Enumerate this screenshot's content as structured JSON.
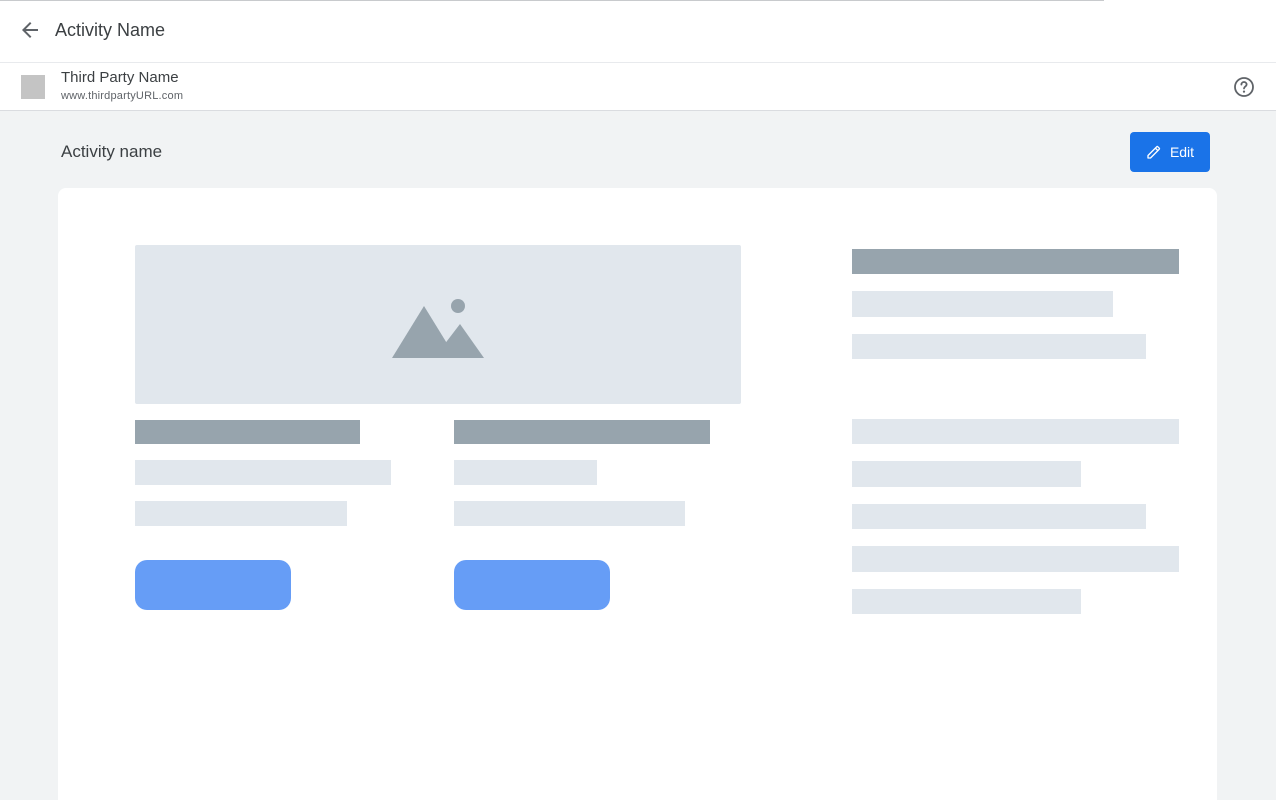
{
  "header": {
    "title": "Activity Name",
    "back_icon": "arrow-left-icon"
  },
  "third_party": {
    "name": "Third Party Name",
    "url": "www.thirdpartyURL.com",
    "help_icon": "help-circle-icon"
  },
  "section": {
    "title": "Activity name",
    "edit_label": "Edit",
    "edit_icon": "pencil-icon"
  },
  "colors": {
    "accent": "#1a73e8",
    "placeholder_dark": "#97a4ad",
    "placeholder_light": "#e1e7ed",
    "placeholder_button": "#669df6",
    "background": "#f1f3f4"
  },
  "preview": {
    "image_icon": "image-placeholder-icon"
  }
}
